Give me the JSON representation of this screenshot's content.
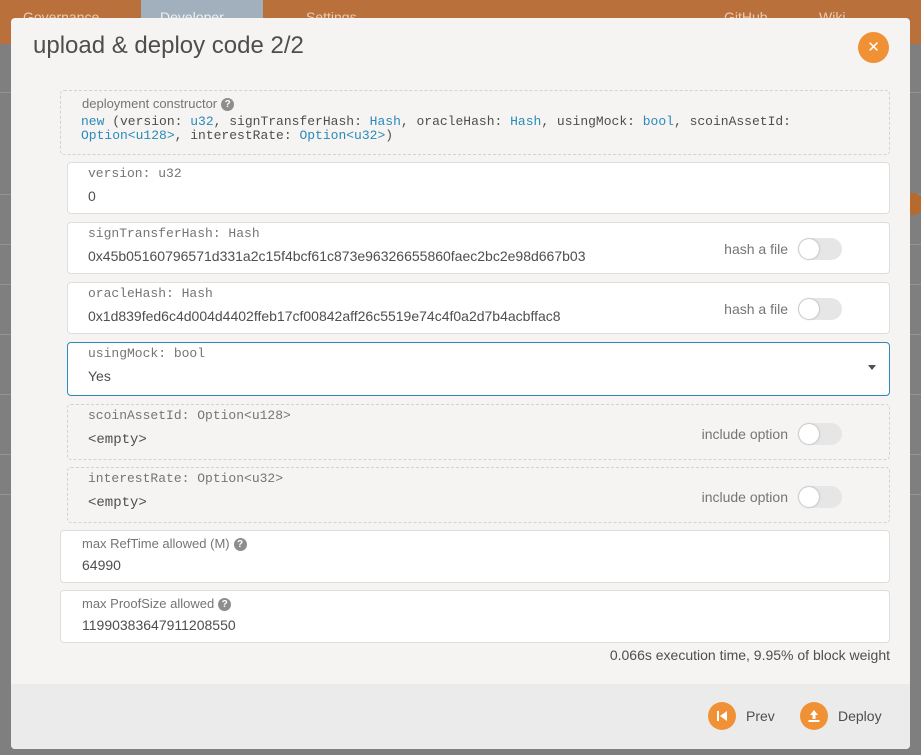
{
  "background": {
    "nav": [
      {
        "label": "Governance"
      },
      {
        "label": "Developer"
      },
      {
        "label": "Settings"
      },
      {
        "label": "GitHub"
      },
      {
        "label": "Wiki"
      }
    ]
  },
  "modal": {
    "title": "upload & deploy code 2/2",
    "close_icon": "close-icon",
    "constructor": {
      "label": "deployment constructor",
      "signature": [
        {
          "text": "new",
          "kw": true
        },
        {
          "text": " (version: ",
          "kw": false
        },
        {
          "text": "u32",
          "kw": true
        },
        {
          "text": ", signTransferHash: ",
          "kw": false
        },
        {
          "text": "Hash",
          "kw": true
        },
        {
          "text": ", oracleHash: ",
          "kw": false
        },
        {
          "text": "Hash",
          "kw": true
        },
        {
          "text": ", usingMock: ",
          "kw": false
        },
        {
          "text": "bool",
          "kw": true
        },
        {
          "text": ", scoinAssetId: ",
          "kw": false
        },
        {
          "text": "Option<u128>",
          "kw": true
        },
        {
          "text": ", interestRate: ",
          "kw": false
        },
        {
          "text": "Option<u32>",
          "kw": true
        },
        {
          "text": ")",
          "kw": false
        }
      ]
    },
    "fields": {
      "version": {
        "label": "version: u32",
        "value": "0"
      },
      "signTransferHash": {
        "label": "signTransferHash: Hash",
        "value": "0x45b05160796571d331a2c15f4bcf61c873e96326655860faec2bc2e98d667b03",
        "toggle_label": "hash a file"
      },
      "oracleHash": {
        "label": "oracleHash: Hash",
        "value": "0x1d839fed6c4d004d4402ffeb17cf00842aff26c5519e74c4f0a2d7b4acbffac8",
        "toggle_label": "hash a file"
      },
      "usingMock": {
        "label": "usingMock: bool",
        "value": "Yes"
      },
      "scoinAssetId": {
        "label": "scoinAssetId: Option<u128>",
        "value": "<empty>",
        "toggle_label": "include option"
      },
      "interestRate": {
        "label": "interestRate: Option<u32>",
        "value": "<empty>",
        "toggle_label": "include option"
      }
    },
    "weights": {
      "refTime": {
        "label": "max RefTime allowed (M)",
        "value": "64990"
      },
      "proofSize": {
        "label": "max ProofSize allowed",
        "value": "11990383647911208550"
      }
    },
    "execution": "0.066s execution time, 9.95% of block weight",
    "footer": {
      "prev_label": "Prev",
      "deploy_label": "Deploy"
    }
  }
}
